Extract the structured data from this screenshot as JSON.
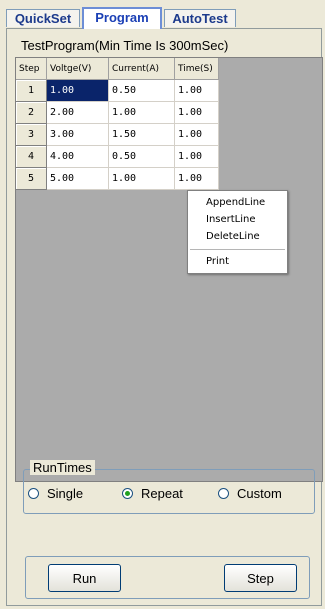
{
  "tabs": [
    {
      "label": "QuickSet"
    },
    {
      "label": "Program",
      "active": true
    },
    {
      "label": "AutoTest"
    }
  ],
  "program_title": "TestProgram(Min Time Is 300mSec)",
  "grid": {
    "columns": [
      "Step",
      "Voltge(V)",
      "Current(A)",
      "Time(S)"
    ],
    "rows": [
      {
        "step": "1",
        "voltage": "1.00",
        "current": "0.50",
        "time": "1.00"
      },
      {
        "step": "2",
        "voltage": "2.00",
        "current": "1.00",
        "time": "1.00"
      },
      {
        "step": "3",
        "voltage": "3.00",
        "current": "1.50",
        "time": "1.00"
      },
      {
        "step": "4",
        "voltage": "4.00",
        "current": "0.50",
        "time": "1.00"
      },
      {
        "step": "5",
        "voltage": "5.00",
        "current": "1.00",
        "time": "1.00"
      }
    ],
    "selected_cell": "row 1 voltage"
  },
  "context_menu": {
    "items": [
      {
        "label": "AppendLine"
      },
      {
        "label": "InsertLine"
      },
      {
        "label": "DeleteLine"
      },
      {
        "label": "Print"
      }
    ]
  },
  "run_times": {
    "label": "RunTimes",
    "options": [
      {
        "label": "Single",
        "selected": false
      },
      {
        "label": "Repeat",
        "selected": true
      },
      {
        "label": "Custom",
        "selected": false
      }
    ]
  },
  "buttons": {
    "run": "Run",
    "step": "Step"
  },
  "colors": {
    "selection": "#0a246a",
    "tab_text": "#1c3a8c",
    "radio_dot": "#21a121"
  }
}
